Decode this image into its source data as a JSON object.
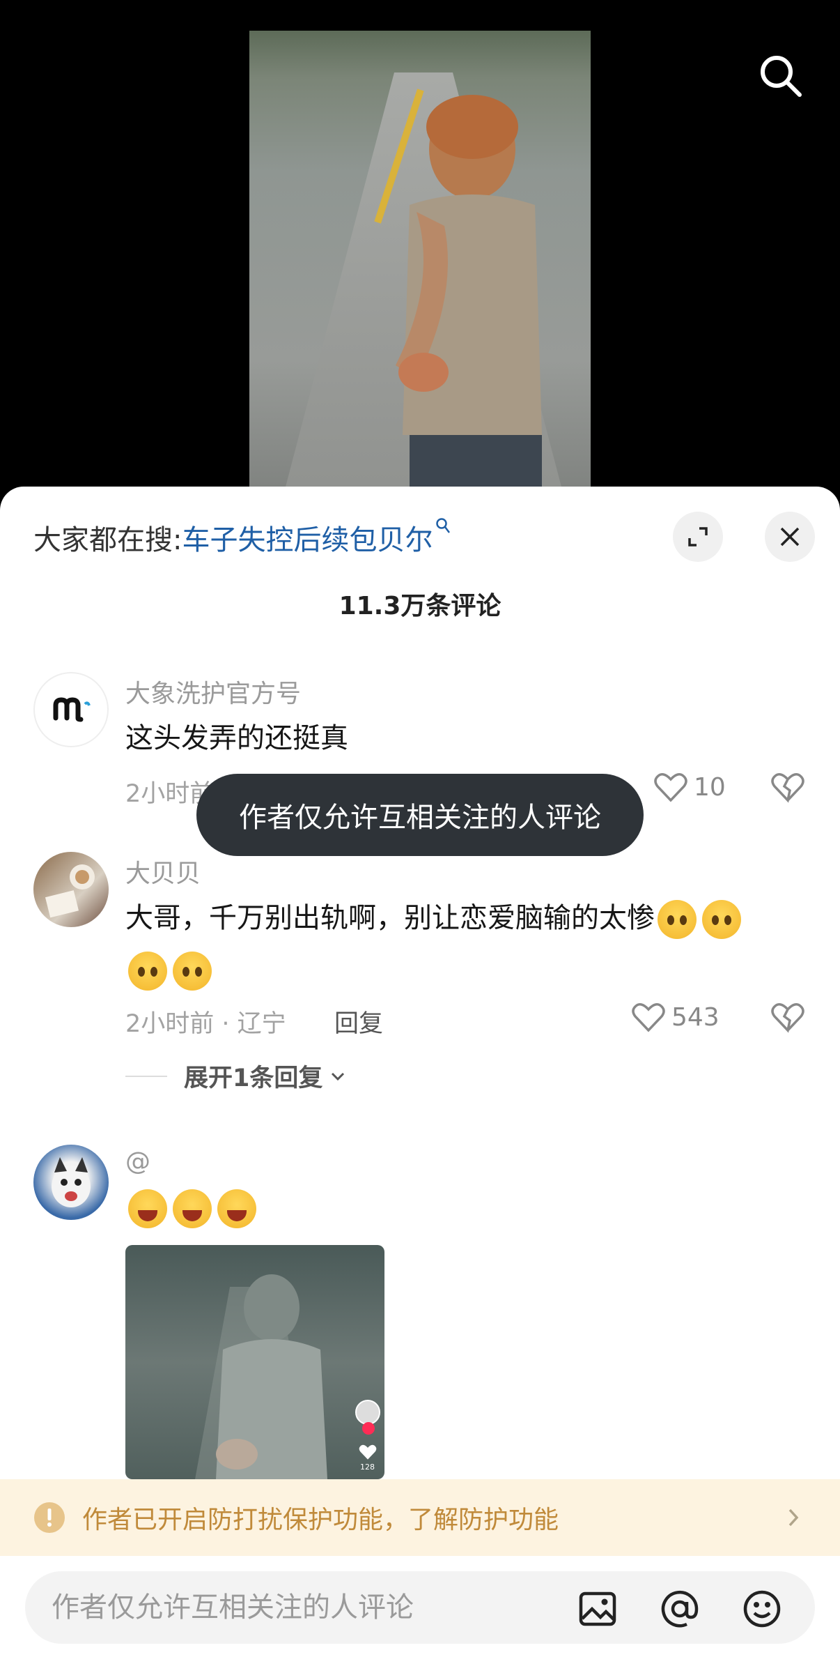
{
  "header": {
    "search_prefix": "大家都在搜:",
    "search_keyword": "车子失控后续包贝尔"
  },
  "comments_count": "11.3万条评论",
  "toast": "作者仅允许互相关注的人评论",
  "comments": [
    {
      "name": "大象洗护官方号",
      "text": "这头发弄的还挺真",
      "time": "2小时前",
      "likes": "10"
    },
    {
      "name": "大贝贝",
      "text": "大哥，千万别出轨啊，别让恋爱脑输的太惨",
      "time": "2小时前 · 辽宁",
      "reply_label": "回复",
      "likes": "543",
      "expand_label": "展开1条回复"
    },
    {
      "name": "@",
      "media_likes": "128"
    }
  ],
  "notice": {
    "text": "作者已开启防打扰保护功能，了解防护功能"
  },
  "input": {
    "placeholder": "作者仅允许互相关注的人评论"
  },
  "icons": [
    "search-icon",
    "expand-icon",
    "close-icon",
    "heart-icon",
    "broken-heart-icon",
    "chevron-down-icon",
    "alert-icon",
    "chevron-right-icon",
    "image-icon",
    "at-icon",
    "emoji-icon"
  ]
}
